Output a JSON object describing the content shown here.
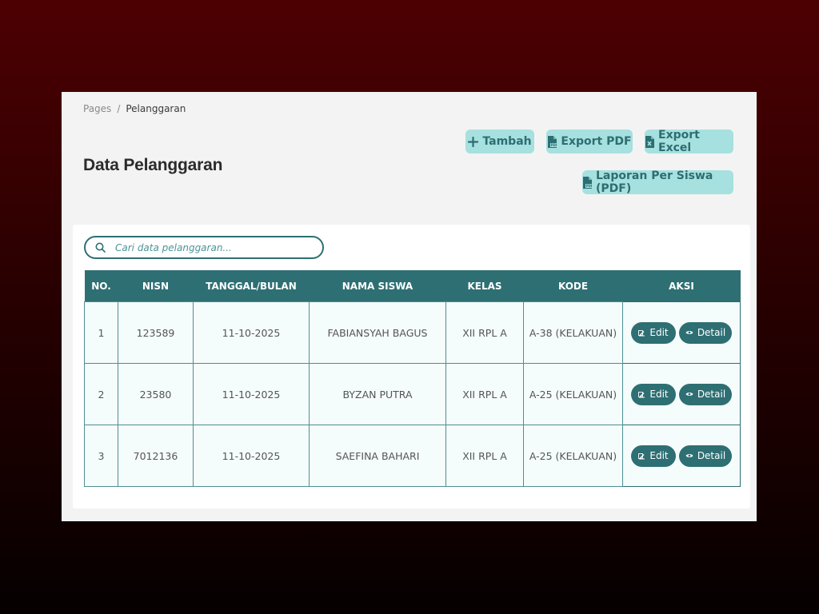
{
  "breadcrumb": {
    "root": "Pages",
    "separator": "/",
    "current": "Pelanggaran"
  },
  "page_title": "Data Pelanggaran",
  "buttons": {
    "tambah": "Tambah",
    "export_pdf": "Export PDF",
    "export_excel": "Export Excel",
    "laporan": "Laporan Per Siswa (PDF)"
  },
  "search": {
    "placeholder": "Cari data pelanggaran..."
  },
  "table": {
    "headers": [
      "NO.",
      "NISN",
      "TANGGAL/BULAN",
      "NAMA SISWA",
      "KELAS",
      "KODE",
      "AKSI"
    ],
    "rows": [
      {
        "no": "1",
        "nisn": "123589",
        "tanggal": "11-10-2025",
        "nama": "FABIANSYAH BAGUS",
        "kelas": "XII RPL A",
        "kode": "A-38 (KELAKUAN)"
      },
      {
        "no": "2",
        "nisn": "23580",
        "tanggal": "11-10-2025",
        "nama": "BYZAN PUTRA",
        "kelas": "XII RPL A",
        "kode": "A-25 (KELAKUAN)"
      },
      {
        "no": "3",
        "nisn": "7012136",
        "tanggal": "11-10-2025",
        "nama": "SAEFINA BAHARI",
        "kelas": "XII RPL A",
        "kode": "A-25 (KELAKUAN)"
      }
    ],
    "actions": {
      "edit": "Edit",
      "detail": "Detail"
    }
  },
  "colors": {
    "primary": "#2e6f73",
    "button_bg": "#a6e0df",
    "button_text": "#2d6e72",
    "row_bg": "#f5fcfc",
    "panel_bg": "#f3f3f3"
  },
  "icons": {
    "tambah": "plus-icon",
    "export_pdf": "file-pdf-icon",
    "export_excel": "file-excel-icon",
    "laporan": "file-pdf-icon",
    "search": "search-icon",
    "edit": "edit-icon",
    "detail": "eye-icon"
  }
}
